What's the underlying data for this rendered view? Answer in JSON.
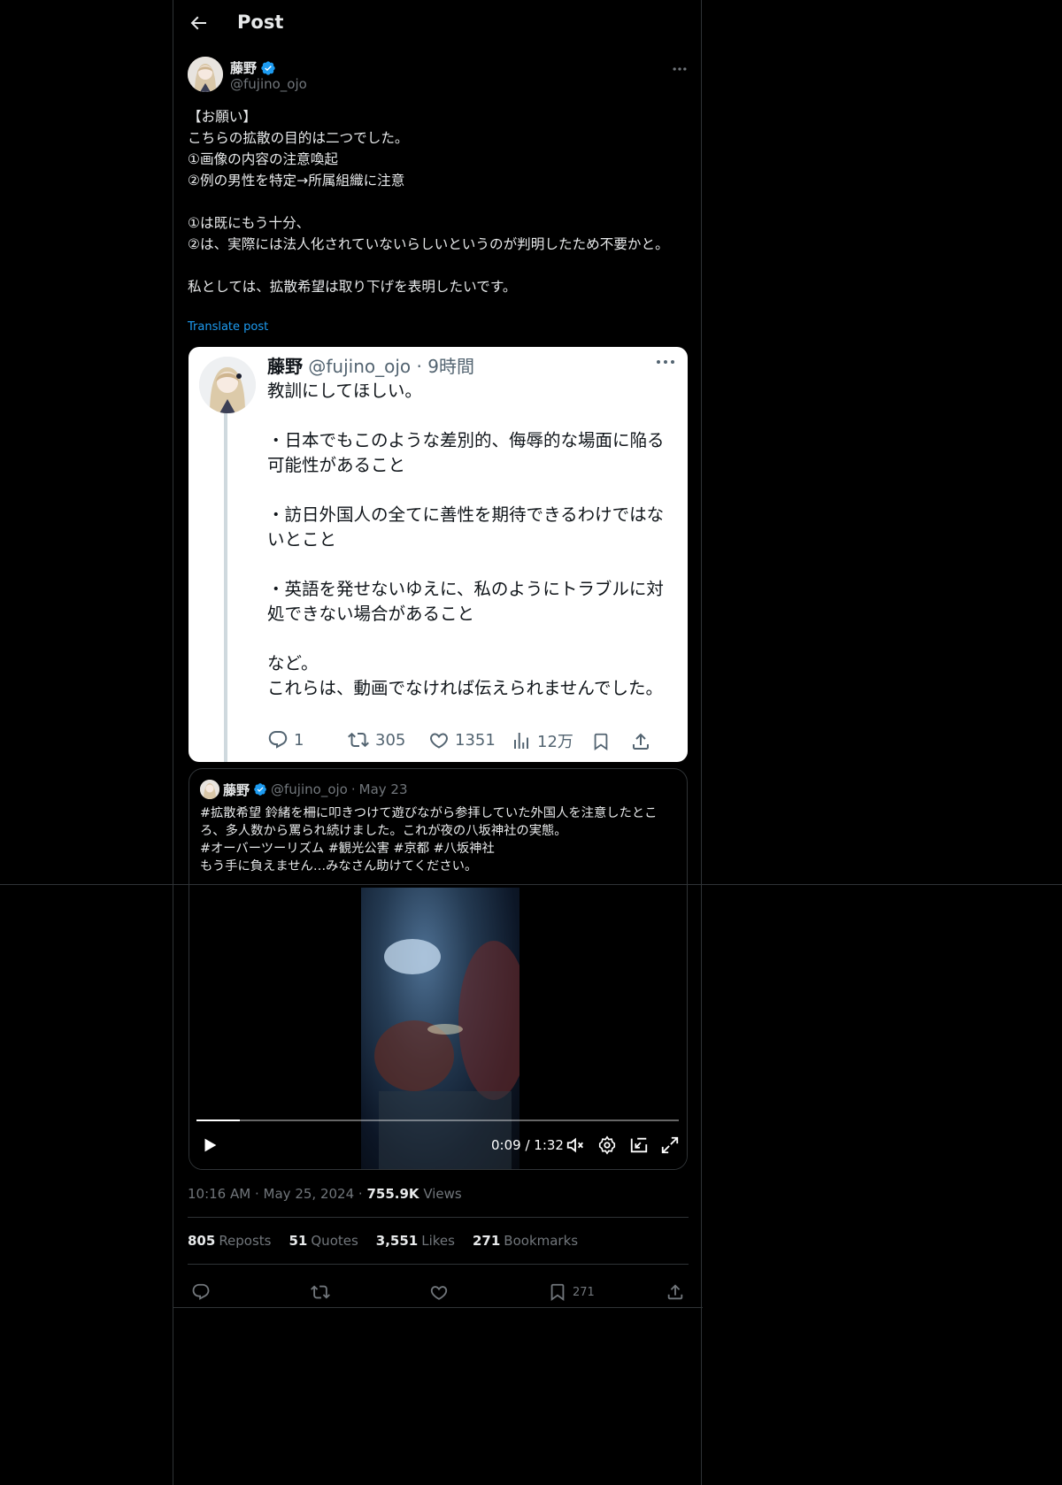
{
  "header": {
    "title": "Post"
  },
  "author": {
    "display_name": "藤野",
    "handle": "@fujino_ojo"
  },
  "post": {
    "text": "【お願い】\nこちらの拡散の目的は二つでした。\n①画像の内容の注意喚起\n②例の男性を特定→所属組織に注意\n\n①は既にもう十分、\n②は、実際には法人化されていないらしいというのが判明したため不要かと。\n\n私としては、拡散希望は取り下げを表明したいです。",
    "translate_label": "Translate post"
  },
  "screenshot": {
    "display_name": "藤野",
    "handle": "@fujino_ojo",
    "time": "· 9時間",
    "text": "教訓にしてほしい。\n\n・日本でもこのような差別的、侮辱的な場面に陥る可能性があること\n\n・訪日外国人の全てに善性を期待できるわけではないとこと\n\n・英語を発せないゆえに、私のようにトラブルに対処できない場合があること\n\nなど。\nこれらは、動画でなければ伝えられませんでした。",
    "replies": "1",
    "reposts": "305",
    "likes": "1351",
    "views": "12万"
  },
  "quote": {
    "display_name": "藤野",
    "handle": "@fujino_ojo",
    "dot": "·",
    "date": "May 23",
    "text": "#拡散希望 鈴緒を柵に叩きつけて遊びながら参拝していた外国人を注意したところ、多人数から罵られ続けました。これが夜の八坂神社の実態。\n#オーバーツーリズム #観光公害 #京都 #八坂神社\nもう手に負えません…みなさん助けてください。",
    "video": {
      "time": "0:09 / 1:32",
      "progress": 0.09
    }
  },
  "meta": {
    "time": "10:16 AM",
    "dot": "·",
    "date": "May 25, 2024",
    "views_count": "755.9K",
    "views_label": "Views"
  },
  "stats": {
    "reposts_count": "805",
    "reposts_label": "Reposts",
    "quotes_count": "51",
    "quotes_label": "Quotes",
    "likes_count": "3,551",
    "likes_label": "Likes",
    "bookmarks_count": "271",
    "bookmarks_label": "Bookmarks"
  },
  "actions": {
    "bookmark_count": "271"
  },
  "colors": {
    "background": "#000000",
    "accent": "#1d9bf0",
    "text": "#e7e9ea",
    "muted": "#71767b",
    "border": "#2f3336"
  },
  "icons": [
    "back-arrow-icon",
    "verified-badge-icon",
    "more-icon",
    "reply-icon",
    "repost-icon",
    "like-icon",
    "views-icon",
    "bookmark-icon",
    "share-icon",
    "play-icon",
    "mute-icon",
    "settings-icon",
    "pip-icon",
    "fullscreen-icon"
  ]
}
